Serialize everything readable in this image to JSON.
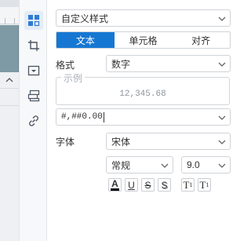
{
  "panel": {
    "style_select": {
      "value": "自定义样式"
    },
    "tabs": [
      {
        "label": "文本",
        "active": true
      },
      {
        "label": "单元格",
        "active": false
      },
      {
        "label": "对齐",
        "active": false
      }
    ],
    "format": {
      "label": "格式",
      "value": "数字"
    },
    "example": {
      "legend": "示例",
      "value": "12,345.68"
    },
    "pattern": {
      "value": "#,##0.00"
    },
    "font": {
      "label": "字体",
      "family": "宋体",
      "style": "常规",
      "size": "9.0"
    },
    "text_format_buttons": [
      {
        "name": "font-color",
        "glyph": "A"
      },
      {
        "name": "underline",
        "glyph": "U"
      },
      {
        "name": "strikethrough",
        "glyph": "S"
      },
      {
        "name": "shadow",
        "glyph": "S"
      },
      {
        "name": "superscript",
        "glyph": "T",
        "sub": "1"
      },
      {
        "name": "subscript",
        "glyph": "T",
        "sub": "1"
      }
    ]
  },
  "colors": {
    "accent": "#1677d2",
    "icon_blue": "#2f7bd3",
    "icon_gray": "#4a5563",
    "canvas_cell": "#7e9aa4"
  },
  "icons": [
    "layout-icon",
    "crop-icon",
    "dropdown-box-icon",
    "form-field-icon",
    "link-icon"
  ]
}
